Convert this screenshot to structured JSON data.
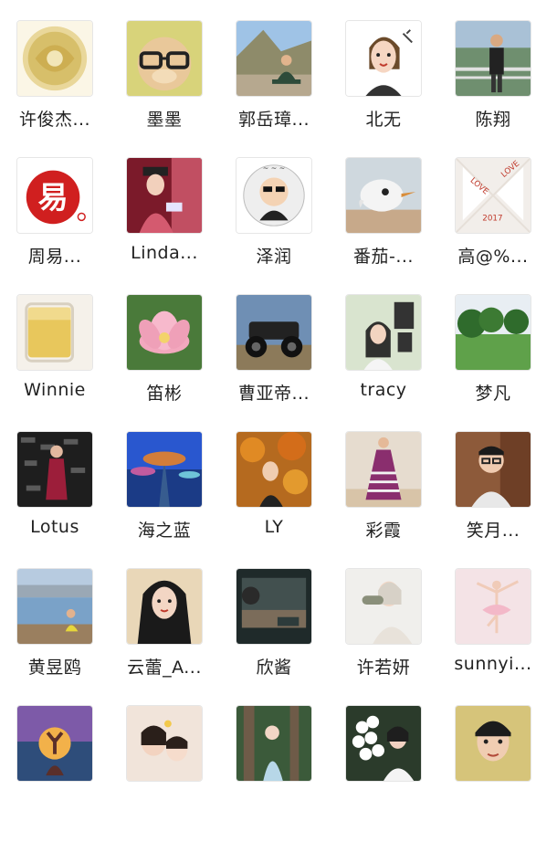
{
  "contacts": [
    {
      "name": "许俊杰...",
      "avatar": "golden-dragon-seal"
    },
    {
      "name": "墨墨",
      "avatar": "plush-toy-glasses"
    },
    {
      "name": "郭岳璋...",
      "avatar": "man-meditating-rock"
    },
    {
      "name": "北无",
      "avatar": "cartoon-woman-sketch"
    },
    {
      "name": "陈翔",
      "avatar": "man-standing-railing"
    },
    {
      "name": "周易...",
      "avatar": "red-yi-seal-logo"
    },
    {
      "name": "Linda...",
      "avatar": "woman-qing-costume"
    },
    {
      "name": "泽润",
      "avatar": "cartoon-monk-sticker"
    },
    {
      "name": "番茄-...",
      "avatar": "cartoon-bird"
    },
    {
      "name": "高@%...",
      "avatar": "love-paper-fold"
    },
    {
      "name": "Winnie",
      "avatar": "glass-of-tea"
    },
    {
      "name": "笛彬",
      "avatar": "pink-lotus-flower"
    },
    {
      "name": "曹亚帝...",
      "avatar": "atv-vehicle"
    },
    {
      "name": "tracy",
      "avatar": "woman-green-wall"
    },
    {
      "name": "梦凡",
      "avatar": "green-lawn-trees"
    },
    {
      "name": "Lotus",
      "avatar": "woman-event-backdrop"
    },
    {
      "name": "海之蓝",
      "avatar": "supertree-night"
    },
    {
      "name": "LY",
      "avatar": "woman-autumn-leaves"
    },
    {
      "name": "彩霞",
      "avatar": "woman-striped-dress"
    },
    {
      "name": "笑月...",
      "avatar": "man-with-glasses"
    },
    {
      "name": "黄昱鸥",
      "avatar": "person-lakeside"
    },
    {
      "name": "云蕾_A...",
      "avatar": "woman-long-hair"
    },
    {
      "name": "欣酱",
      "avatar": "dark-train-window"
    },
    {
      "name": "许若妍",
      "avatar": "woman-drinking"
    },
    {
      "name": "sunnyi...",
      "avatar": "ballet-dancer"
    },
    {
      "name": "",
      "avatar": "yoga-sunset"
    },
    {
      "name": "",
      "avatar": "mother-and-child"
    },
    {
      "name": "",
      "avatar": "child-in-forest"
    },
    {
      "name": "",
      "avatar": "woman-white-flowers"
    },
    {
      "name": "",
      "avatar": "young-man-portrait"
    }
  ]
}
